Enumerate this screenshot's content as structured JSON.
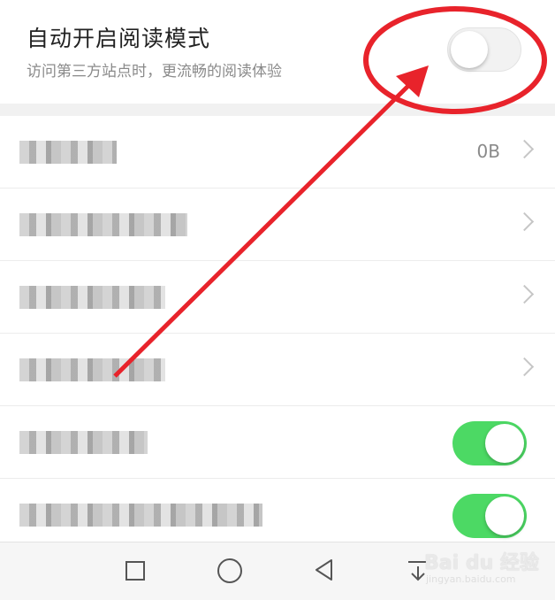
{
  "reading_mode": {
    "title": "自动开启阅读模式",
    "subtitle": "访问第三方站点时，更流畅的阅读体验",
    "toggle_state": "off"
  },
  "settings_rows": [
    {
      "value": "0B",
      "control": "chevron"
    },
    {
      "control": "chevron"
    },
    {
      "control": "chevron"
    },
    {
      "control": "chevron"
    },
    {
      "control": "toggle",
      "toggle_state": "on"
    },
    {
      "control": "toggle",
      "toggle_state": "on"
    }
  ],
  "nav_bar": {
    "icons": [
      "square-icon",
      "circle-home-icon",
      "back-triangle-icon",
      "notification-down-icon"
    ]
  },
  "watermark": {
    "main": "Bai du 经验",
    "sub": "jingyan.baidu.com"
  },
  "colors": {
    "toggle_on": "#4cd964",
    "annotation": "#e8232b"
  }
}
